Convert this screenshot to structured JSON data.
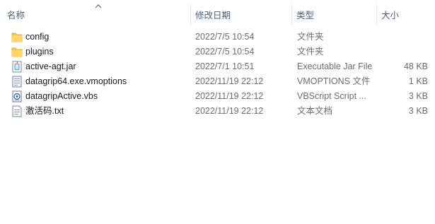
{
  "columns": {
    "name": "名称",
    "date": "修改日期",
    "type": "类型",
    "size": "大小"
  },
  "files": [
    {
      "icon": "folder-icon",
      "name": "config",
      "date": "2022/7/5 10:54",
      "type": "文件夹",
      "size": ""
    },
    {
      "icon": "folder-icon",
      "name": "plugins",
      "date": "2022/7/5 10:54",
      "type": "文件夹",
      "size": ""
    },
    {
      "icon": "jar-file-icon",
      "name": "active-agt.jar",
      "date": "2022/7/1 10:51",
      "type": "Executable Jar File",
      "size": "48 KB"
    },
    {
      "icon": "vmoptions-file-icon",
      "name": "datagrip64.exe.vmoptions",
      "date": "2022/11/19 22:12",
      "type": "VMOPTIONS 文件",
      "size": "1 KB"
    },
    {
      "icon": "vbs-script-icon",
      "name": "datagripActive.vbs",
      "date": "2022/11/19 22:12",
      "type": "VBScript Script ...",
      "size": "3 KB"
    },
    {
      "icon": "text-file-icon",
      "name": "激活码.txt",
      "date": "2022/11/19 22:12",
      "type": "文本文档",
      "size": "3 KB"
    }
  ]
}
